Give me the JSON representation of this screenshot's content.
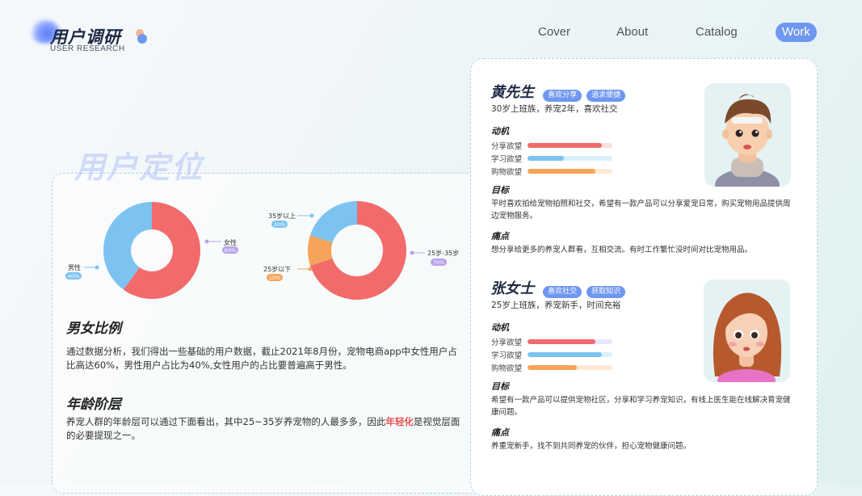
{
  "brand": {
    "title": "用户调研",
    "subtitle": "USER RESEARCH"
  },
  "nav": {
    "items": [
      {
        "label": "Cover"
      },
      {
        "label": "About"
      },
      {
        "label": "Catalog"
      },
      {
        "label": "Work",
        "active": true
      }
    ]
  },
  "left": {
    "big_title": "用户定位",
    "gender_title": "男女比例",
    "gender_text": "通过数据分析，我们得出一些基础的用户数据，截止2021年8月份，宠物电商app中女性用户占比高达60%，男性用户占比为40%,女性用户的占比要普遍高于男性。",
    "age_title": "年龄阶层",
    "age_text_a": "养宠人群的年龄层可以通过下面看出，其中25~35岁养宠物的人最多多，因此",
    "age_text_hl": "年轻化",
    "age_text_b": "是视觉层面的必要提现之一。"
  },
  "chart_data": [
    {
      "type": "pie",
      "title": "",
      "categories": [
        "女性",
        "男性"
      ],
      "values": [
        60,
        40
      ],
      "labels": [
        "60%",
        "40%"
      ],
      "colors": [
        "#f26b6b",
        "#7cc3f1"
      ],
      "pill_colors": [
        "#b8a2ea",
        "#7cc3f1"
      ]
    },
    {
      "type": "pie",
      "title": "",
      "categories": [
        "25岁-35岁",
        "25岁以下",
        "35岁以上"
      ],
      "values": [
        70,
        10,
        20
      ],
      "labels": [
        "70%",
        "10%",
        "20%"
      ],
      "colors": [
        "#f26b6b",
        "#f5a45a",
        "#7cc3f1"
      ],
      "pill_colors": [
        "#b8a2ea",
        "#f5a45a",
        "#7cc3f1"
      ]
    }
  ],
  "personas": [
    {
      "name": "黄先生",
      "tags": [
        "喜欢分享",
        "追求便捷"
      ],
      "desc": "30岁上班族，养宠2年，喜欢社交",
      "motive_label": "动机",
      "bars": [
        {
          "label": "分享欲望",
          "value": 0.88,
          "color": "#f26b6b",
          "track": "#fbe0e0"
        },
        {
          "label": "学习欲望",
          "value": 0.43,
          "color": "#7cc3f1",
          "track": "#dcf0fb"
        },
        {
          "label": "购物欲望",
          "value": 0.8,
          "color": "#f5a45a",
          "track": "#fde8d6"
        }
      ],
      "goal_label": "目标",
      "goal": "平时喜欢拍给宠物拍照和社交，希望有一款产品可以分享爱宠日常，购买宠物用品提供周边宠物服务。",
      "pain_label": "痛点",
      "pain": "想分享给更多的养宠人群看，互相交流。有时工作繁忙没时间对比宠物用品。",
      "avatar": "male-avatar"
    },
    {
      "name": "张女士",
      "tags": [
        "喜欢社交",
        "获取知识"
      ],
      "desc": "25岁上班族，养宠新手，时间充裕",
      "motive_label": "动机",
      "bars": [
        {
          "label": "分享欲望",
          "value": 0.8,
          "color": "#f26b6b",
          "track": "#e8e6fb"
        },
        {
          "label": "学习欲望",
          "value": 0.88,
          "color": "#7cc3f1",
          "track": "#dcf0fb"
        },
        {
          "label": "购物欲望",
          "value": 0.58,
          "color": "#f5a45a",
          "track": "#fde8d6"
        }
      ],
      "goal_label": "目标",
      "goal": "希望有一款产品可以提供宠物社区，分享和学习养宠知识，有线上医生能在线解决育宠健康问题。",
      "pain_label": "痛点",
      "pain": "养重宠新手，找不到共同养宠的伙伴，担心宠物健康问题。",
      "avatar": "female-avatar"
    }
  ]
}
